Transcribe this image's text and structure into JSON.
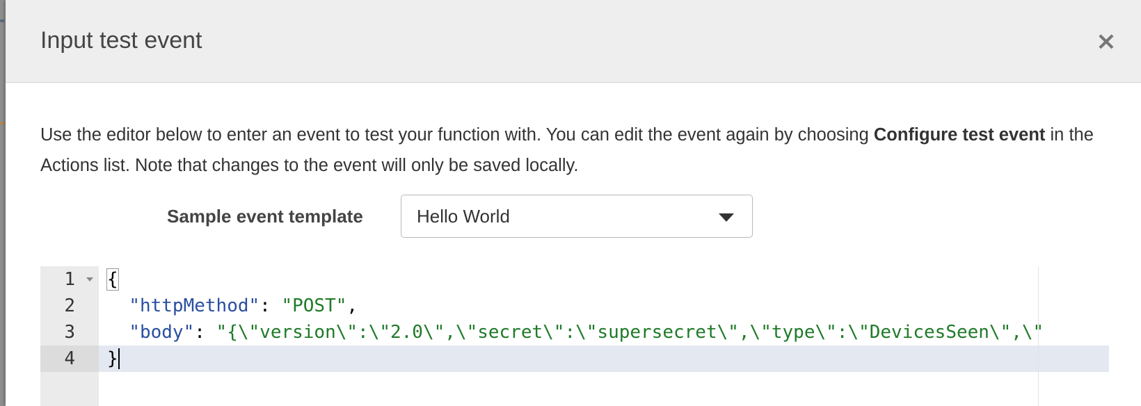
{
  "modal": {
    "title": "Input test event",
    "close_symbol": "×"
  },
  "description": {
    "text_1": "Use the editor below to enter an event to test your function with. You can edit the event again by choosing ",
    "bold_1": "Configure test event",
    "text_2": " in the Actions list. Note that changes to the event will only be saved locally."
  },
  "template": {
    "label": "Sample event template",
    "selected": "Hello World"
  },
  "editor": {
    "line_numbers": [
      "1",
      "2",
      "3",
      "4"
    ],
    "line1": {
      "open_brace": "{"
    },
    "line2": {
      "indent": "  ",
      "key": "\"httpMethod\"",
      "sep": ": ",
      "value": "\"POST\"",
      "trail": ","
    },
    "line3": {
      "indent": "  ",
      "key": "\"body\"",
      "sep": ": ",
      "value": "\"{\\\"version\\\":\\\"2.0\\\",\\\"secret\\\":\\\"supersecret\\\",\\\"type\\\":\\\"DevicesSeen\\\",\\\""
    },
    "line4": {
      "close_brace": "}"
    }
  },
  "colors": {
    "json_key": "#2a4fa0",
    "json_string": "#1f7a28",
    "active_line": "#e3e8f1",
    "gutter": "#ebebeb"
  },
  "icons": {
    "close": "close-icon",
    "dropdown": "caret-down-icon",
    "fold": "fold-arrow-icon"
  }
}
